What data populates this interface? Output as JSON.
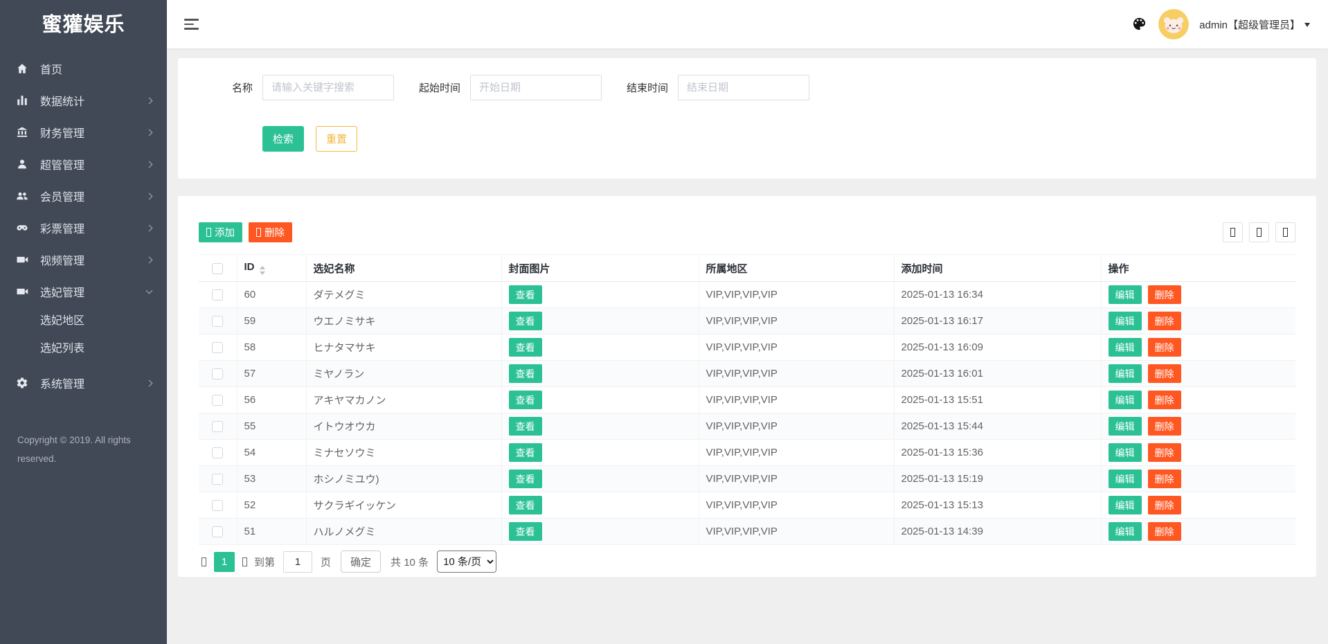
{
  "app": {
    "logo": "蜜獾娱乐"
  },
  "colors": {
    "accent": "#2bc195",
    "danger": "#ff5722",
    "warning": "#f4b63f",
    "sidebar": "#414956",
    "bg": "#efefef"
  },
  "header": {
    "admin_label": "admin【超级管理员】"
  },
  "sidebar": {
    "items": [
      {
        "label": "首页",
        "icon": "home-icon"
      },
      {
        "label": "数据统计",
        "icon": "bar-chart-icon"
      },
      {
        "label": "财务管理",
        "icon": "bank-icon"
      },
      {
        "label": "超管管理",
        "icon": "user-icon"
      },
      {
        "label": "会员管理",
        "icon": "users-icon"
      },
      {
        "label": "彩票管理",
        "icon": "gamepad-icon"
      },
      {
        "label": "视频管理",
        "icon": "video-icon"
      },
      {
        "label": "选妃管理",
        "icon": "video-icon",
        "expanded": true,
        "children": [
          "选妃地区",
          "选妃列表"
        ]
      },
      {
        "label": "系统管理",
        "icon": "gear-icon"
      }
    ],
    "copyright": "Copyright © 2019. All rights reserved."
  },
  "search": {
    "name_label": "名称",
    "name_placeholder": "请输入关键字搜索",
    "start_label": "起始时间",
    "start_placeholder": "开始日期",
    "end_label": "结束时间",
    "end_placeholder": "结束日期",
    "search_btn": "检索",
    "reset_btn": "重置"
  },
  "toolbar": {
    "add": "添加",
    "delete": "删除"
  },
  "table": {
    "columns": [
      "ID",
      "选妃名称",
      "封面图片",
      "所属地区",
      "添加时间",
      "操作"
    ],
    "view_btn": "查看",
    "edit_btn": "编辑",
    "del_btn": "删除",
    "rows": [
      {
        "id": "60",
        "name": "ダテメグミ",
        "region": "VIP,VIP,VIP,VIP",
        "time": "2025-01-13 16:34"
      },
      {
        "id": "59",
        "name": "ウエノミサキ",
        "region": "VIP,VIP,VIP,VIP",
        "time": "2025-01-13 16:17"
      },
      {
        "id": "58",
        "name": "ヒナタマサキ",
        "region": "VIP,VIP,VIP,VIP",
        "time": "2025-01-13 16:09"
      },
      {
        "id": "57",
        "name": "ミヤノラン",
        "region": "VIP,VIP,VIP,VIP",
        "time": "2025-01-13 16:01"
      },
      {
        "id": "56",
        "name": "アキヤマカノン",
        "region": "VIP,VIP,VIP,VIP",
        "time": "2025-01-13 15:51"
      },
      {
        "id": "55",
        "name": "イトウオウカ",
        "region": "VIP,VIP,VIP,VIP",
        "time": "2025-01-13 15:44"
      },
      {
        "id": "54",
        "name": "ミナセソウミ",
        "region": "VIP,VIP,VIP,VIP",
        "time": "2025-01-13 15:36"
      },
      {
        "id": "53",
        "name": "ホシノミユウ)",
        "region": "VIP,VIP,VIP,VIP",
        "time": "2025-01-13 15:19"
      },
      {
        "id": "52",
        "name": "サクラギイッケン",
        "region": "VIP,VIP,VIP,VIP",
        "time": "2025-01-13 15:13"
      },
      {
        "id": "51",
        "name": "ハルノメグミ",
        "region": "VIP,VIP,VIP,VIP",
        "time": "2025-01-13 14:39"
      }
    ]
  },
  "pagination": {
    "page": "1",
    "goto_prefix": "到第",
    "goto_value": "1",
    "goto_suffix": "页",
    "confirm": "确定",
    "total": "共 10 条",
    "per_page": "10 条/页"
  }
}
